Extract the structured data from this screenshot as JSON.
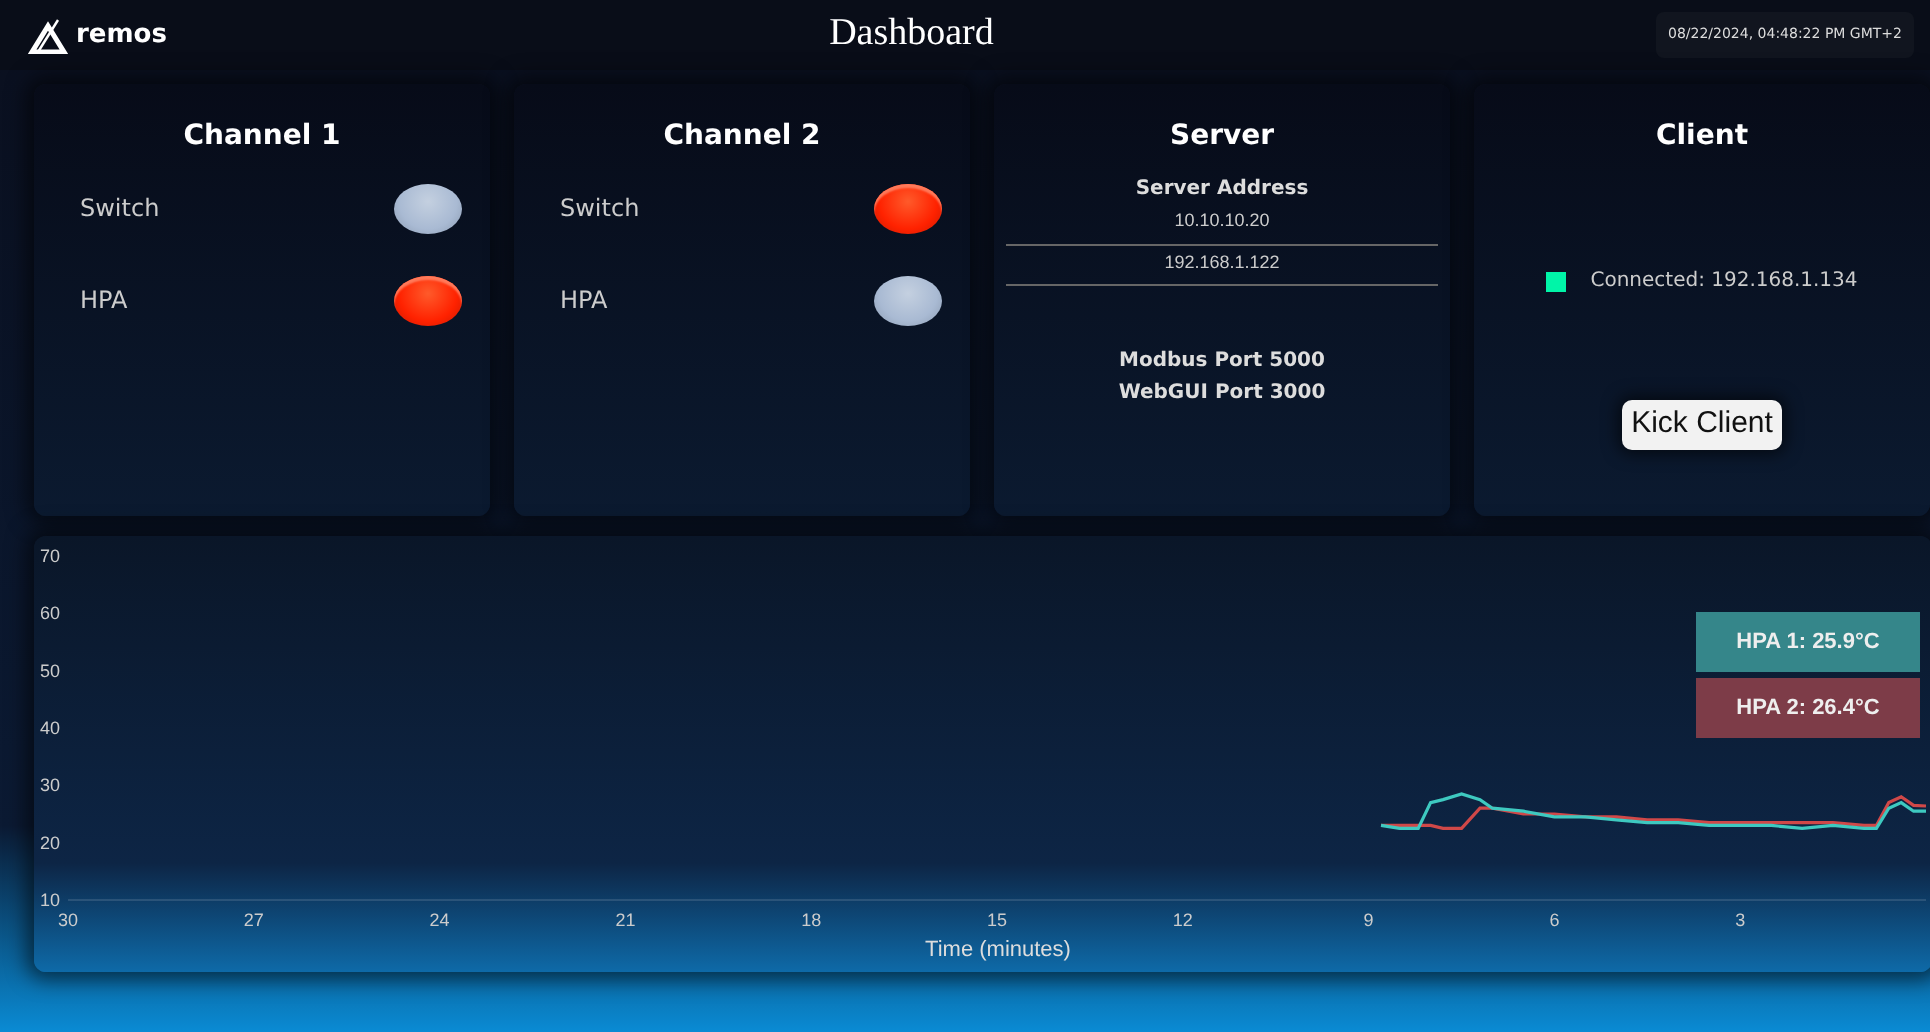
{
  "header": {
    "brand": "remos",
    "title": "Dashboard",
    "datetime": "08/22/2024, 04:48:22 PM GMT+2"
  },
  "channels": [
    {
      "title": "Channel 1",
      "indicators": [
        {
          "label": "Switch",
          "on": false
        },
        {
          "label": "HPA",
          "on": true
        }
      ]
    },
    {
      "title": "Channel 2",
      "indicators": [
        {
          "label": "Switch",
          "on": true
        },
        {
          "label": "HPA",
          "on": false
        }
      ]
    }
  ],
  "server": {
    "title": "Server",
    "address_label": "Server Address",
    "addresses": [
      "10.10.10.20",
      "192.168.1.122"
    ],
    "ports": [
      "Modbus Port 5000",
      "WebGUI Port 3000"
    ]
  },
  "client": {
    "title": "Client",
    "status": "Connected: 192.168.1.134",
    "color": "#00f5a8",
    "button": "Kick Client"
  },
  "temperature": {
    "legend": [
      {
        "label": "HPA 1: 25.9°C",
        "color": "#35868a"
      },
      {
        "label": "HPA 2: 26.4°C",
        "color": "#7d3c48"
      }
    ],
    "chart_data": {
      "type": "line",
      "xlabel": "Time (minutes)",
      "xlim": [
        30,
        0
      ],
      "ylim": [
        10,
        70
      ],
      "xticks": [
        30,
        27,
        24,
        21,
        18,
        15,
        12,
        9,
        6,
        3
      ],
      "yticks": [
        10,
        20,
        30,
        40,
        50,
        60,
        70
      ],
      "x": [
        8.8,
        8.5,
        8.2,
        8.0,
        7.8,
        7.5,
        7.2,
        7.0,
        6.5,
        6.0,
        5.5,
        5.0,
        4.5,
        4.0,
        3.5,
        3.0,
        2.5,
        2.0,
        1.5,
        1.0,
        0.8,
        0.6,
        0.4,
        0.2,
        0.0
      ],
      "series": [
        {
          "color": "#3ec9c0",
          "values": [
            23,
            22.5,
            22.5,
            27,
            27.5,
            28.5,
            27.5,
            26,
            25.5,
            24.5,
            24.5,
            24,
            23.5,
            23.5,
            23,
            23,
            23,
            22.5,
            23,
            22.5,
            22.5,
            26,
            27,
            25.5,
            25.5
          ]
        },
        {
          "color": "#d04848",
          "values": [
            23,
            23,
            23,
            23,
            22.5,
            22.5,
            26,
            26,
            25,
            25,
            24.5,
            24.5,
            24,
            24,
            23.5,
            23.5,
            23.5,
            23.5,
            23.5,
            23,
            23,
            27,
            28,
            26.5,
            26.4
          ]
        }
      ]
    }
  }
}
